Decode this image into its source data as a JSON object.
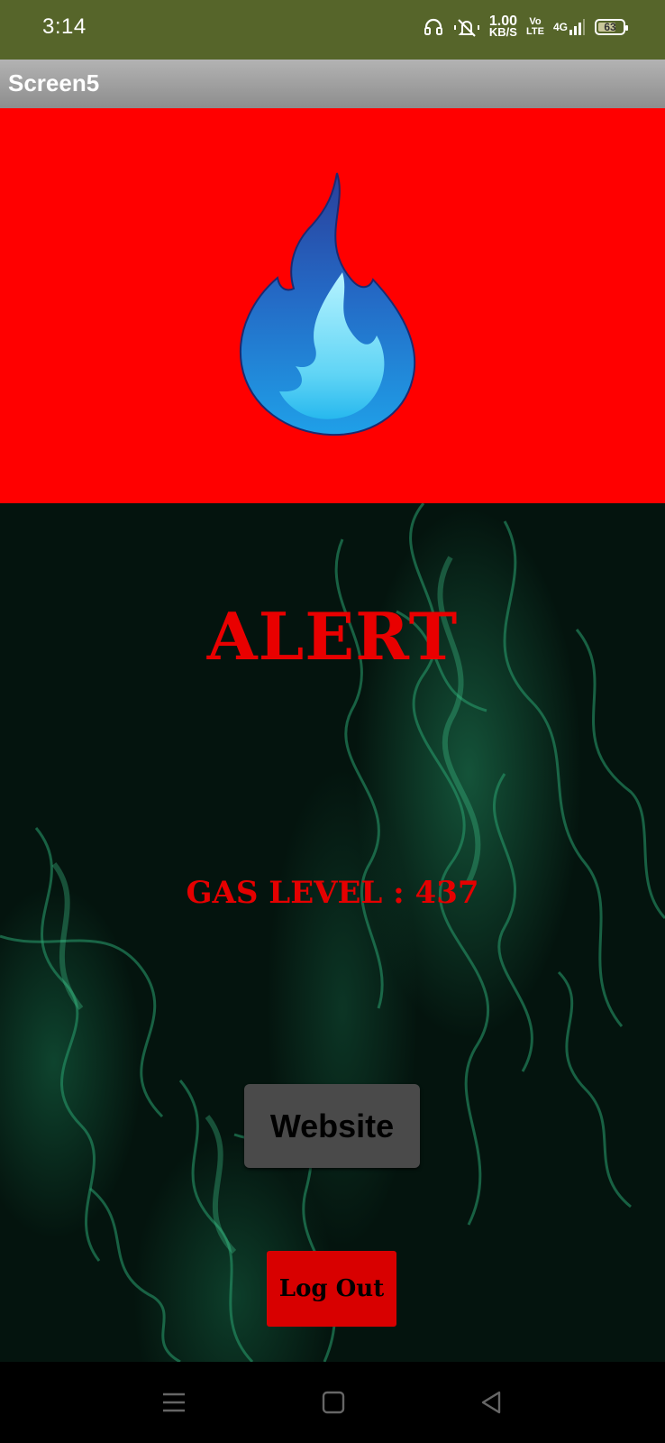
{
  "status_bar": {
    "time": "3:14",
    "net_speed_value": "1.00",
    "net_speed_unit": "KB/S",
    "volte_top": "Vo",
    "volte_bottom": "LTE",
    "network": "4G",
    "battery": "63",
    "icons": [
      "headphones-icon",
      "mute-vibrate-icon",
      "signal-icon",
      "battery-icon"
    ]
  },
  "app_bar": {
    "title": "Screen5"
  },
  "banner": {
    "icon": "gas-flame-icon",
    "background": "#ff0000"
  },
  "main": {
    "alert_text": "ALERT",
    "gas_level_text": "GAS LEVEL : 437",
    "website_button": "Website",
    "logout_button": "Log Out"
  },
  "nav_bar": {
    "icons": [
      "menu-icon",
      "home-icon",
      "back-icon"
    ]
  },
  "colors": {
    "status_bar": "#56652a",
    "alert_red": "#e90000",
    "smoke_green": "#2aa070"
  }
}
